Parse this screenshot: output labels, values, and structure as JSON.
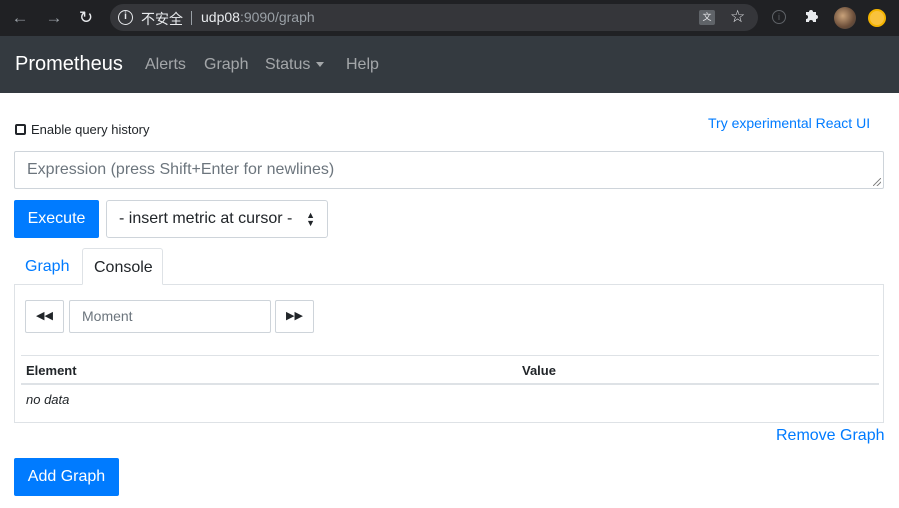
{
  "browser": {
    "insecure_label": "不安全",
    "url_host": "udp08",
    "url_rest": ":9090/graph",
    "icons": [
      "back-icon",
      "forward-icon",
      "reload-icon",
      "info-icon",
      "translate-icon",
      "star-icon",
      "extension-puzzle-icon",
      "avatar"
    ]
  },
  "navbar": {
    "brand": "Prometheus",
    "links": [
      "Alerts",
      "Graph",
      "Status",
      "Help"
    ]
  },
  "query": {
    "history_label": "Enable query history",
    "history_checked": false,
    "react_link": "Try experimental React UI",
    "expression_placeholder": "Expression (press Shift+Enter for newlines)",
    "execute_label": "Execute",
    "metric_select": "- insert metric at cursor -"
  },
  "tabs": [
    "Graph",
    "Console"
  ],
  "active_tab": "Console",
  "console": {
    "moment_placeholder": "Moment",
    "columns": [
      "Element",
      "Value"
    ],
    "empty_text": "no data"
  },
  "remove_graph_label": "Remove Graph",
  "add_graph_label": "Add Graph",
  "colors": {
    "primary": "#007bff",
    "navbar_bg": "#343a40",
    "chrome_bg": "#202124"
  }
}
